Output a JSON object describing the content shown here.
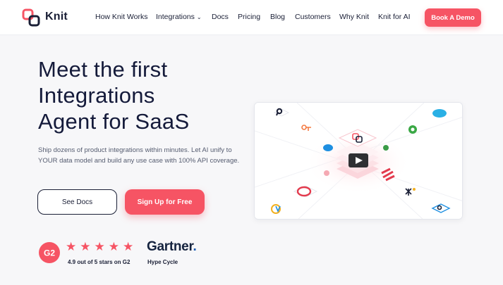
{
  "brand": {
    "name": "Knit",
    "accent": "#f65464"
  },
  "nav": {
    "links": [
      {
        "label": "How Knit Works",
        "dropdown": false
      },
      {
        "label": "Integrations",
        "dropdown": true
      },
      {
        "label": "Docs",
        "dropdown": false
      },
      {
        "label": "Pricing",
        "dropdown": false
      },
      {
        "label": "Blog",
        "dropdown": false
      },
      {
        "label": "Customers",
        "dropdown": false
      },
      {
        "label": "Why Knit",
        "dropdown": false
      },
      {
        "label": "Knit for AI",
        "dropdown": false
      }
    ],
    "cta": "Book A Demo"
  },
  "hero": {
    "title_lines": [
      "Meet the first",
      "Integrations",
      "Agent for SaaS"
    ],
    "description": "Ship dozens of product integrations within minutes. Let AI unify to YOUR data model and build any use case with 100% API coverage.",
    "secondary_button": "See Docs",
    "primary_button": "Sign Up for Free"
  },
  "ratings": {
    "g2_badge": "G2",
    "stars": 5,
    "g2_text": "4.9 out of 5 stars on G2",
    "gartner": "Gartner",
    "gartner_caption": "Hype Cycle"
  },
  "video": {
    "icons": [
      "play-icon",
      "knit-logo-icon"
    ]
  }
}
